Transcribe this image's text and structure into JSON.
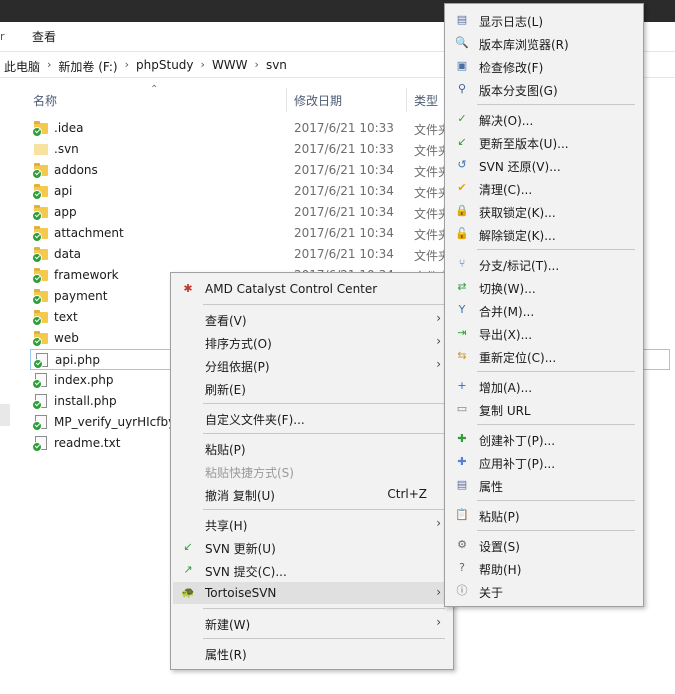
{
  "ribbon": {
    "tab_view": "查看",
    "edge_mark": "r"
  },
  "address": {
    "crumbs": [
      "此电脑",
      "新加卷 (F:)",
      "phpStudy",
      "WWW",
      "svn"
    ]
  },
  "columns": {
    "name": "名称",
    "modified": "修改日期",
    "type": "类型"
  },
  "files": [
    {
      "name": ".idea",
      "date": "2017/6/21 10:33",
      "type": "文件夹",
      "kind": "folder",
      "status": "ok"
    },
    {
      "name": ".svn",
      "date": "2017/6/21 10:33",
      "type": "文件夹",
      "kind": "plain-folder",
      "status": "none"
    },
    {
      "name": "addons",
      "date": "2017/6/21 10:34",
      "type": "文件夹",
      "kind": "folder",
      "status": "ok"
    },
    {
      "name": "api",
      "date": "2017/6/21 10:34",
      "type": "文件夹",
      "kind": "folder",
      "status": "ok"
    },
    {
      "name": "app",
      "date": "2017/6/21 10:34",
      "type": "文件夹",
      "kind": "folder",
      "status": "ok"
    },
    {
      "name": "attachment",
      "date": "2017/6/21 10:34",
      "type": "文件夹",
      "kind": "folder",
      "status": "ok"
    },
    {
      "name": "data",
      "date": "2017/6/21 10:34",
      "type": "文件夹",
      "kind": "folder",
      "status": "ok"
    },
    {
      "name": "framework",
      "date": "2017/6/21 10:34",
      "type": "文件夹",
      "kind": "folder",
      "status": "ok"
    },
    {
      "name": "payment",
      "date": "",
      "type": "",
      "kind": "folder",
      "status": "ok"
    },
    {
      "name": "text",
      "date": "",
      "type": "",
      "kind": "folder",
      "status": "ok"
    },
    {
      "name": "web",
      "date": "",
      "type": "",
      "kind": "folder",
      "status": "ok"
    },
    {
      "name": "api.php",
      "date": "",
      "type": "",
      "kind": "file",
      "status": "ok",
      "selected": true
    },
    {
      "name": "index.php",
      "date": "",
      "type": "",
      "kind": "file",
      "status": "ok"
    },
    {
      "name": "install.php",
      "date": "",
      "type": "",
      "kind": "file",
      "status": "ok"
    },
    {
      "name": "MP_verify_uyrHIcfby",
      "date": "",
      "type": "",
      "kind": "file",
      "status": "ok"
    },
    {
      "name": "readme.txt",
      "date": "",
      "type": "",
      "kind": "file",
      "status": "ok"
    }
  ],
  "context_menu": {
    "items": [
      {
        "label": "AMD Catalyst Control Center",
        "icon": "amd-icon"
      },
      {
        "sep": true
      },
      {
        "label": "查看(V)",
        "submenu": true
      },
      {
        "label": "排序方式(O)",
        "submenu": true
      },
      {
        "label": "分组依据(P)",
        "submenu": true
      },
      {
        "label": "刷新(E)"
      },
      {
        "sep": true
      },
      {
        "label": "自定义文件夹(F)..."
      },
      {
        "sep": true
      },
      {
        "label": "粘贴(P)"
      },
      {
        "label": "粘贴快捷方式(S)",
        "disabled": true
      },
      {
        "label": "撤消 复制(U)",
        "shortcut": "Ctrl+Z"
      },
      {
        "sep": true
      },
      {
        "label": "共享(H)",
        "submenu": true
      },
      {
        "label": "SVN 更新(U)",
        "icon": "svn-update-icon"
      },
      {
        "label": "SVN 提交(C)...",
        "icon": "svn-commit-icon"
      },
      {
        "label": "TortoiseSVN",
        "icon": "tortoisesvn-icon",
        "submenu": true,
        "highlight": true
      },
      {
        "sep": true
      },
      {
        "label": "新建(W)",
        "submenu": true
      },
      {
        "sep": true
      },
      {
        "label": "属性(R)"
      }
    ]
  },
  "tortoise_menu": {
    "items": [
      {
        "label": "显示日志(L)",
        "icon": "log-icon"
      },
      {
        "label": "版本库浏览器(R)",
        "icon": "repo-browser-icon"
      },
      {
        "label": "检查修改(F)",
        "icon": "check-modifications-icon"
      },
      {
        "label": "版本分支图(G)",
        "icon": "revision-graph-icon"
      },
      {
        "sep": true
      },
      {
        "label": "解决(O)...",
        "icon": "resolve-icon"
      },
      {
        "label": "更新至版本(U)...",
        "icon": "update-to-revision-icon"
      },
      {
        "label": "SVN 还原(V)...",
        "icon": "revert-icon"
      },
      {
        "label": "清理(C)...",
        "icon": "cleanup-icon"
      },
      {
        "label": "获取锁定(K)...",
        "icon": "lock-icon"
      },
      {
        "label": "解除锁定(K)...",
        "icon": "unlock-icon"
      },
      {
        "sep": true
      },
      {
        "label": "分支/标记(T)...",
        "icon": "branch-icon"
      },
      {
        "label": "切换(W)...",
        "icon": "switch-icon"
      },
      {
        "label": "合并(M)...",
        "icon": "merge-icon"
      },
      {
        "label": "导出(X)...",
        "icon": "export-icon"
      },
      {
        "label": "重新定位(C)...",
        "icon": "relocate-icon"
      },
      {
        "sep": true
      },
      {
        "label": "增加(A)...",
        "icon": "add-icon"
      },
      {
        "label": "复制 URL",
        "icon": "copy-url-icon"
      },
      {
        "sep": true
      },
      {
        "label": "创建补丁(P)...",
        "icon": "create-patch-icon"
      },
      {
        "label": "应用补丁(P)...",
        "icon": "apply-patch-icon"
      },
      {
        "label": "属性",
        "icon": "properties-icon"
      },
      {
        "sep": true
      },
      {
        "label": "粘贴(P)",
        "icon": "paste-icon"
      },
      {
        "sep": true
      },
      {
        "label": "设置(S)",
        "icon": "settings-icon"
      },
      {
        "label": "帮助(H)",
        "icon": "help-icon"
      },
      {
        "label": "关于",
        "icon": "about-icon"
      }
    ]
  },
  "icons": {
    "amd-icon": "✱",
    "svn-update-icon": "↙",
    "svn-commit-icon": "↗",
    "tortoisesvn-icon": "🐢",
    "log-icon": "▤",
    "repo-browser-icon": "🔍",
    "check-modifications-icon": "▣",
    "revision-graph-icon": "⚲",
    "resolve-icon": "✓",
    "update-to-revision-icon": "↙",
    "revert-icon": "↺",
    "cleanup-icon": "✔",
    "lock-icon": "🔒",
    "unlock-icon": "🔓",
    "branch-icon": "⑂",
    "switch-icon": "⇄",
    "merge-icon": "Y",
    "export-icon": "⇥",
    "relocate-icon": "⇆",
    "add-icon": "+",
    "copy-url-icon": "▭",
    "create-patch-icon": "✚",
    "apply-patch-icon": "✚",
    "properties-icon": "▤",
    "paste-icon": "📋",
    "settings-icon": "⚙",
    "help-icon": "?",
    "about-icon": "ⓘ"
  },
  "icon_colors": {
    "amd-icon": "#c0392b",
    "svn-update-icon": "#2f9e39",
    "svn-commit-icon": "#2f9e39",
    "tortoisesvn-icon": "#6b8e23",
    "log-icon": "#5a6ea0",
    "repo-browser-icon": "#4a6fa5",
    "check-modifications-icon": "#4a6fa5",
    "revision-graph-icon": "#3b5998",
    "resolve-icon": "#2f9e39",
    "update-to-revision-icon": "#2f9e39",
    "revert-icon": "#3b6fb0",
    "cleanup-icon": "#e0a800",
    "lock-icon": "#c89b2a",
    "unlock-icon": "#c89b2a",
    "branch-icon": "#3b6fb0",
    "switch-icon": "#2f9e39",
    "merge-icon": "#3b6fb0",
    "export-icon": "#2f9e39",
    "relocate-icon": "#c89b2a",
    "add-icon": "#1f6fd1",
    "copy-url-icon": "#777777",
    "create-patch-icon": "#2f9e39",
    "apply-patch-icon": "#5b7fd6",
    "properties-icon": "#5a6ea0",
    "paste-icon": "#8a6d3b",
    "settings-icon": "#666666",
    "help-icon": "#666666",
    "about-icon": "#666666"
  }
}
